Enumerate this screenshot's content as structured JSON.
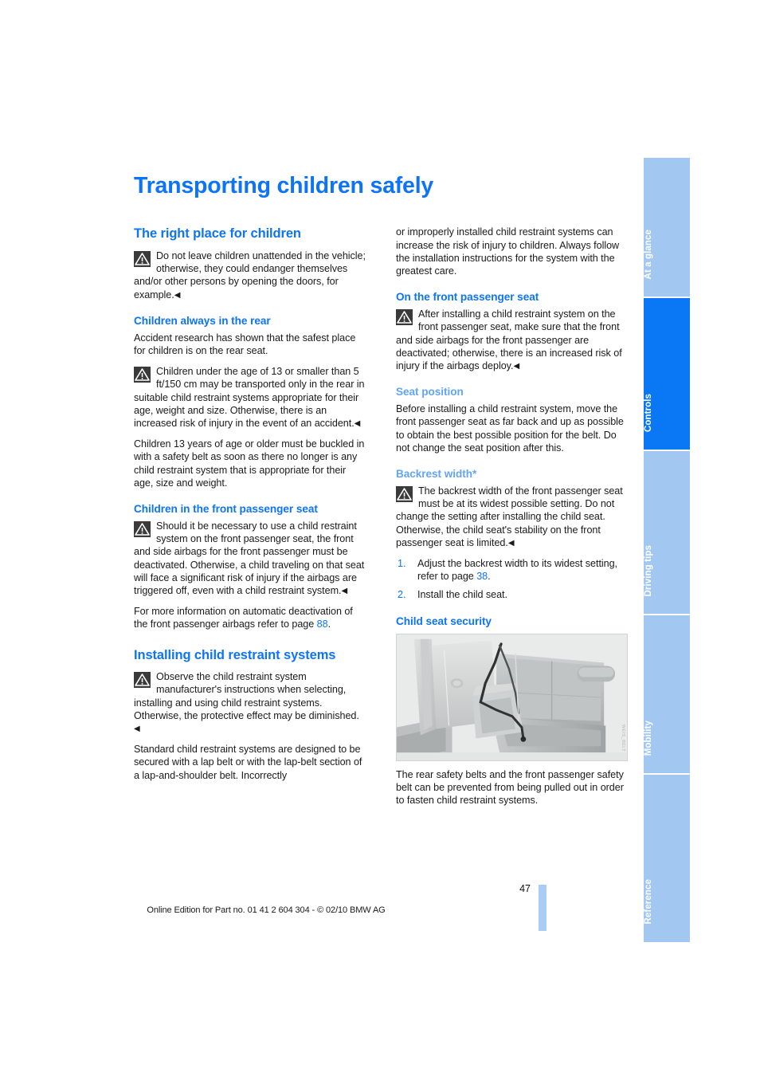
{
  "document": {
    "title": "Transporting children safely",
    "page_number": "47",
    "footer_note": "Online Edition for Part no. 01 41 2 604 304 - © 02/10 BMW AG"
  },
  "tab_rail": {
    "tabs": [
      {
        "label": "At a glance",
        "active": false
      },
      {
        "label": "Controls",
        "active": true
      },
      {
        "label": "Driving tips",
        "active": false
      },
      {
        "label": "Mobility",
        "active": false
      },
      {
        "label": "Reference",
        "active": false
      }
    ]
  },
  "left_column": {
    "section_heading": "The right place for children",
    "warning_1": "Do not leave children unattended in the vehicle; otherwise, they could endanger themselves and/or other persons by opening the doors, for example.",
    "sub_1": {
      "heading": "Children always in the rear",
      "para_1": "Accident research has shown that the safest place for children is on the rear seat.",
      "warning": "Children under the age of 13 or smaller than 5 ft/150 cm may be transported only in the rear in suitable child restraint systems appropriate for their age, weight and size. Otherwise, there is an increased risk of injury in the event of an accident.",
      "para_2": "Children 13 years of age or older must be buckled in with a safety belt as soon as there no longer is any child restraint system that is appropriate for their age, size and weight."
    },
    "sub_2": {
      "heading": "Children in the front passenger seat",
      "warning": "Should it be necessary to use a child restraint system on the front passenger seat, the front and side airbags for the front passenger must be deactivated. Otherwise, a child traveling on that seat will face a significant risk of injury if the airbags are triggered off, even with a child restraint system.",
      "para_lead": "For more information on automatic deactivation of the front passenger airbags refer to page ",
      "para_ref": "88",
      "para_tail": "."
    },
    "section_heading_2": "Installing child restraint systems",
    "warning_2": "Observe the child restraint system manufacturer's instructions when selecting, installing and using child restraint systems. Otherwise, the protective effect may be diminished.",
    "para_tail": "Standard child restraint systems are designed to be secured with a lap belt or with the lap-belt section of a lap-and-shoulder belt. Incorrectly"
  },
  "right_column": {
    "para_continuation": "or improperly installed child restraint systems can increase the risk of injury to children. Always follow the installation instructions for the system with the greatest care.",
    "sub_1": {
      "heading": "On the front passenger seat",
      "warning": "After installing a child restraint system on the front passenger seat, make sure that the front and side airbags for the front passenger are deactivated; otherwise, there is an increased risk of injury if the airbags deploy."
    },
    "sub_2": {
      "heading": "Seat position",
      "para": "Before installing a child restraint system, move the front passenger seat as far back and up as possible to obtain the best possible position for the belt. Do not change the seat position after this."
    },
    "sub_3": {
      "heading": "Backrest width*",
      "warning": "The backrest width of the front passenger seat must be at its widest possible setting. Do not change the setting after installing the child seat. Otherwise, the child seat's stability on the front passenger seat is limited.",
      "steps": [
        {
          "num": "1.",
          "text_lead": "Adjust the backrest width to its widest setting, refer to page ",
          "ref": "38",
          "text_tail": "."
        },
        {
          "num": "2.",
          "text_lead": "Install the child seat.",
          "ref": "",
          "text_tail": ""
        }
      ]
    },
    "sub_4": {
      "heading": "Child seat security",
      "figure_alt": "rear-seat-with-safety-belt-illustration",
      "figure_watermark": "WEIS_BELT",
      "caption": "The rear safety belts and the front passenger safety belt can be prevented from being pulled out in order to fasten child restraint systems."
    }
  },
  "icons": {
    "warning_triangle": "warning-triangle-icon",
    "end_of_warning": "◀"
  },
  "colors": {
    "heading_blue": "#0d74f7",
    "sub_heading_light_blue": "#62a5f5",
    "tab_active": "#0a78f5",
    "tab_inactive": "#a2c8f2",
    "page_marker": "#a9cdf5",
    "warning_icon_bg": "#3a3a3a"
  }
}
